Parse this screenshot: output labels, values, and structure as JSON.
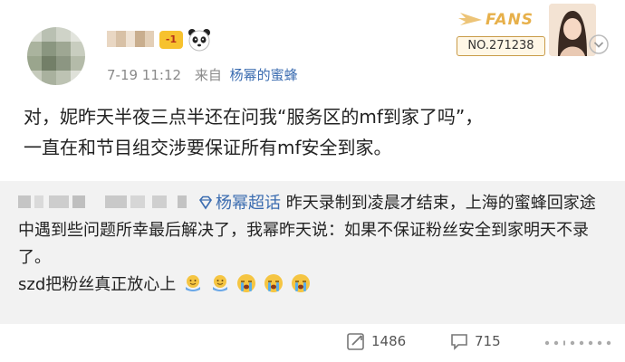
{
  "header": {
    "time": "7-19 11:12",
    "source_label": "来自",
    "source_name": "杨幂的蜜蜂",
    "vip_badge": "-1",
    "fans_badge": {
      "title": "FANS",
      "number": "NO.271238",
      "accent": "#e7b04a"
    }
  },
  "post": {
    "text_line1": "对，妮昨天半夜三点半还在问我“服务区的mf到家了吗”，",
    "text_line2": "一直在和节目组交涉要保证所有mf安全到家。"
  },
  "repost": {
    "topic": "杨幂超话",
    "text_a": " 昨天录制到凌晨才结束，上海的蜜蜂回家途中遇到些问题所幸最后解决了，我幂昨天说：如果不保证粉丝安全到家明天不录了。",
    "text_b": "szd把粉丝真正放心上",
    "emojis": [
      "hugging-emoji",
      "hugging-emoji",
      "crying-emoji",
      "crying-emoji",
      "crying-emoji"
    ]
  },
  "footer": {
    "repost_count": "1486",
    "comment_count": "715"
  },
  "colors": {
    "link": "#3b6cb0",
    "meta": "#8a8a8a",
    "repost_bg": "#f2f2f2"
  }
}
